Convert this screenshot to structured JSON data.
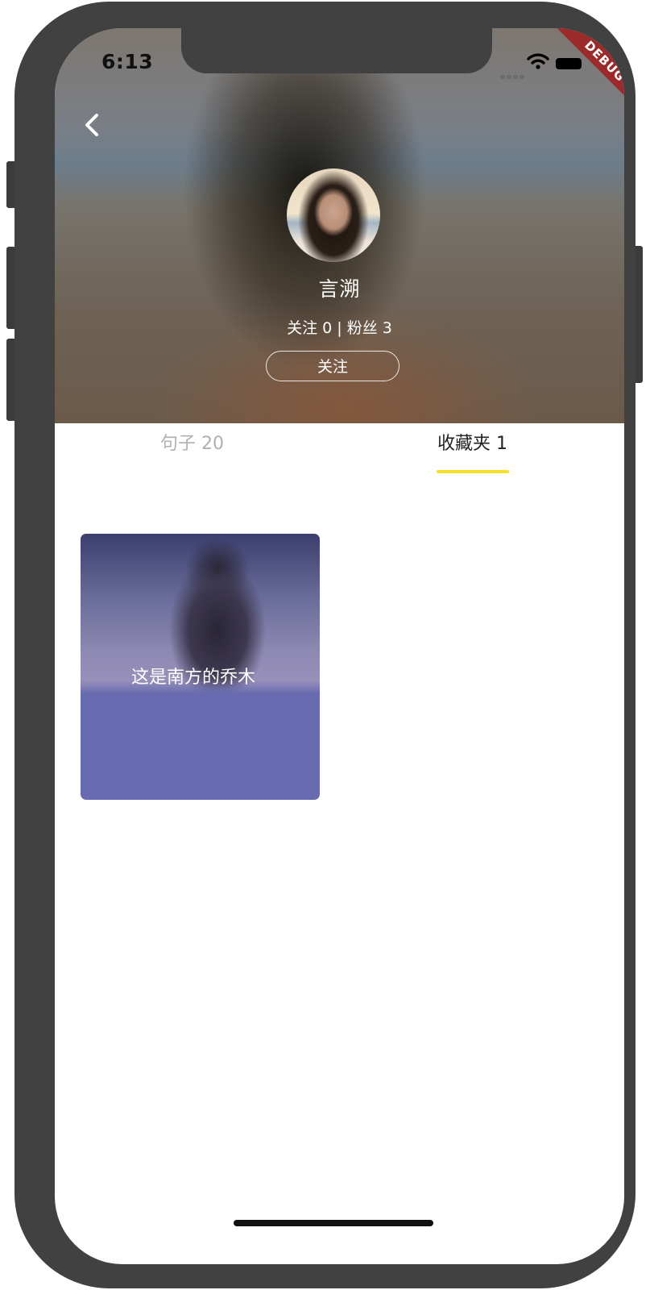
{
  "status_bar": {
    "time": "6:13",
    "debug_label": "DEBUG"
  },
  "profile": {
    "username": "言溯",
    "stats": "关注 0 | 粉丝 3",
    "follow_button": "关注",
    "avatar_icon": "user-avatar-photo"
  },
  "tabs": [
    {
      "label": "句子 20",
      "active": false
    },
    {
      "label": "收藏夹 1",
      "active": true
    }
  ],
  "favorites": [
    {
      "title": "这是南方的乔木"
    }
  ],
  "colors": {
    "accent": "#f7df2a",
    "card_bg": "#686bb0",
    "debug_banner": "#9b2b2b",
    "inactive_tab": "#b0b0b0"
  }
}
